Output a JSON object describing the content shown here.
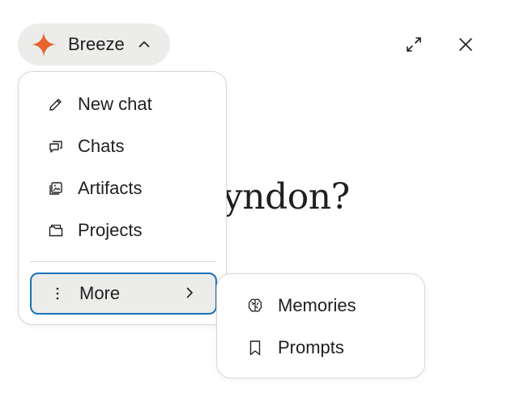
{
  "header": {
    "brand": {
      "name": "Breeze",
      "icon": "sparkle-icon",
      "accent_color": "#e8622c"
    },
    "expand_icon": "expand-icon",
    "close_icon": "close-icon"
  },
  "greeting": {
    "text": ", Lyndon?"
  },
  "menu": {
    "items": [
      {
        "label": "New chat",
        "icon": "pencil-icon"
      },
      {
        "label": "Chats",
        "icon": "chat-bubbles-icon"
      },
      {
        "label": "Artifacts",
        "icon": "artifacts-icon"
      },
      {
        "label": "Projects",
        "icon": "folder-icon"
      }
    ],
    "more": {
      "label": "More",
      "icon": "vertical-dots-icon",
      "highlight_color": "#1a73b8"
    }
  },
  "submenu": {
    "items": [
      {
        "label": "Memories",
        "icon": "brain-icon"
      },
      {
        "label": "Prompts",
        "icon": "bookmark-icon"
      }
    ]
  }
}
